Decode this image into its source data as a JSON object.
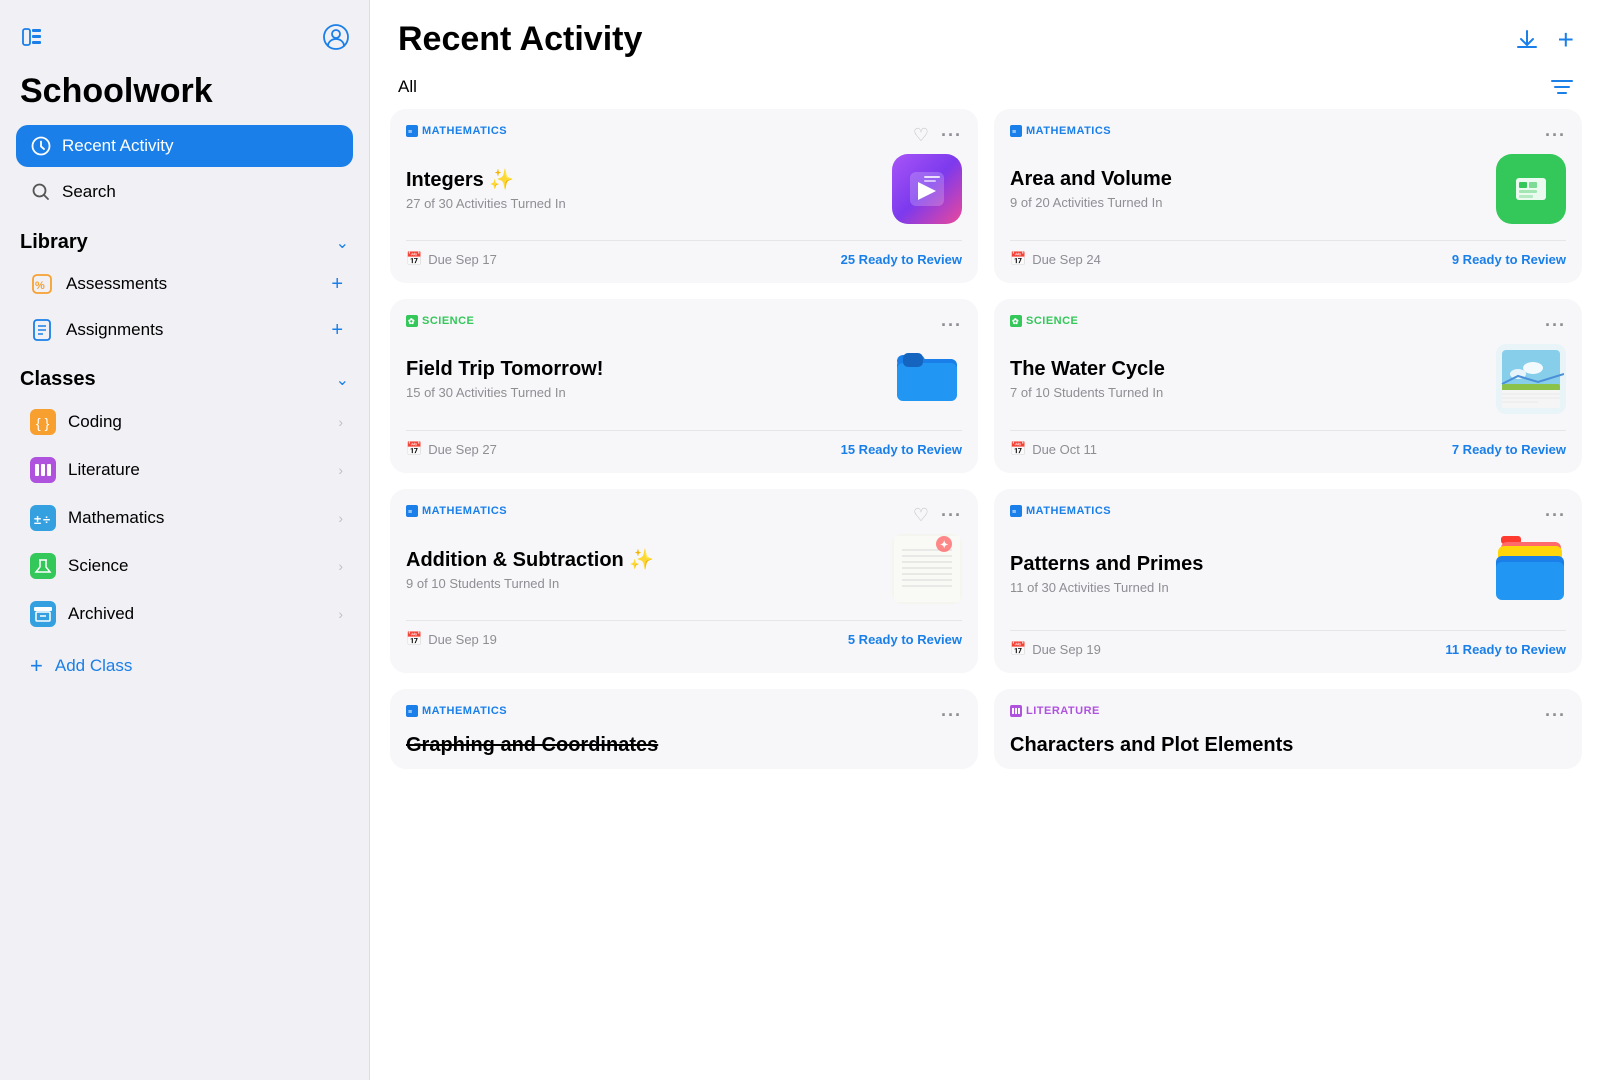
{
  "sidebar": {
    "title": "Schoolwork",
    "nav": {
      "recent_activity": "Recent Activity",
      "search": "Search"
    },
    "library": {
      "heading": "Library",
      "items": [
        {
          "label": "Assessments",
          "icon": "percent-icon"
        },
        {
          "label": "Assignments",
          "icon": "doc-icon"
        }
      ]
    },
    "classes": {
      "heading": "Classes",
      "items": [
        {
          "label": "Coding",
          "color": "#f7a030"
        },
        {
          "label": "Literature",
          "color": "#af52de"
        },
        {
          "label": "Mathematics",
          "color": "#34a0e0"
        },
        {
          "label": "Science",
          "color": "#34c759"
        },
        {
          "label": "Archived",
          "color": "#34a0e0"
        }
      ],
      "add_label": "Add Class"
    }
  },
  "main": {
    "title": "Recent Activity",
    "filter_label": "All",
    "cards": [
      {
        "subject": "MATHEMATICS",
        "subject_type": "math",
        "title": "Integers ✨",
        "subtitle": "27 of 30 Activities Turned In",
        "icon_type": "keynote",
        "due": "Due Sep 17",
        "review": "25 Ready to Review",
        "has_heart": true
      },
      {
        "subject": "MATHEMATICS",
        "subject_type": "math",
        "title": "Area and Volume",
        "subtitle": "9 of 20 Activities Turned In",
        "icon_type": "numbers",
        "due": "Due Sep 24",
        "review": "9 Ready to Review",
        "has_heart": false
      },
      {
        "subject": "SCIENCE",
        "subject_type": "science",
        "title": "Field Trip Tomorrow!",
        "subtitle": "15 of 30 Activities Turned In",
        "icon_type": "folder-blue",
        "due": "Due Sep 27",
        "review": "15 Ready to Review",
        "has_heart": false
      },
      {
        "subject": "SCIENCE",
        "subject_type": "science",
        "title": "The Water Cycle",
        "subtitle": "7 of 10 Students Turned In",
        "icon_type": "doc-image",
        "due": "Due Oct 11",
        "review": "7 Ready to Review",
        "has_heart": false
      },
      {
        "subject": "MATHEMATICS",
        "subject_type": "math",
        "title": "Addition & Subtraction ✨",
        "subtitle": "9 of 10 Students Turned In",
        "icon_type": "doc-list",
        "due": "Due Sep 19",
        "review": "5 Ready to Review",
        "has_heart": true
      },
      {
        "subject": "MATHEMATICS",
        "subject_type": "math",
        "title": "Patterns and Primes",
        "subtitle": "11 of 30 Activities Turned In",
        "icon_type": "folder-blue",
        "due": "Due Sep 19",
        "review": "11 Ready to Review",
        "has_heart": false
      },
      {
        "subject": "MATHEMATICS",
        "subject_type": "math",
        "title": "Graphing and Coordinates",
        "subtitle": "",
        "icon_type": "bar-chart",
        "due": "",
        "review": "",
        "has_heart": false,
        "strikethrough": true
      },
      {
        "subject": "LITERATURE",
        "subject_type": "literature",
        "title": "Characters and Plot Elements",
        "subtitle": "",
        "icon_type": "doc",
        "due": "",
        "review": "",
        "has_heart": false
      }
    ]
  }
}
